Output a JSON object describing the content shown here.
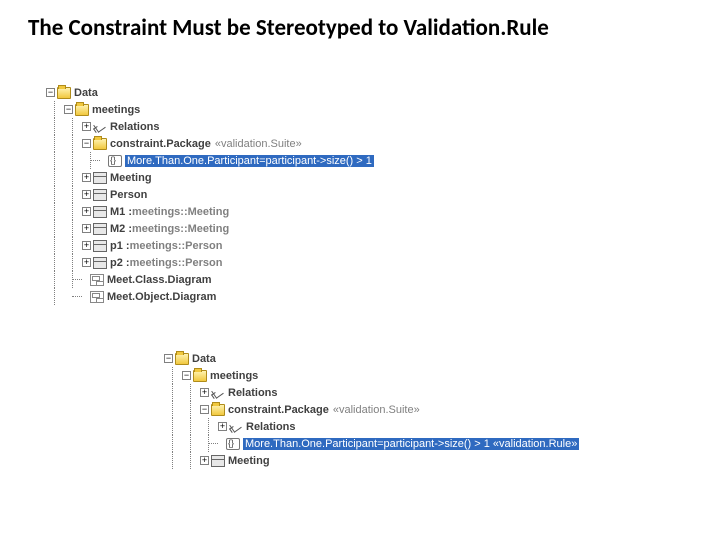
{
  "title": "The Constraint Must be Stereotyped to Validation.Rule",
  "tree1": {
    "data": "Data",
    "meetings": "meetings",
    "relations": "Relations",
    "constraintPackage": "constraint.Package",
    "constraintPackageStereo": "«validation.Suite»",
    "moreThanOne": "More.Than.One.Participant=participant->size() > 1",
    "meeting": "Meeting",
    "person": "Person",
    "m1": "M1 :",
    "m1type": " meetings::Meeting",
    "m2": "M2 :",
    "m2type": " meetings::Meeting",
    "p1": "p1 :",
    "p1type": " meetings::Person",
    "p2": "p2 :",
    "p2type": " meetings::Person",
    "meetClass": "Meet.Class.Diagram",
    "meetObject": "Meet.Object.Diagram"
  },
  "tree2": {
    "data": "Data",
    "meetings": "meetings",
    "relations": "Relations",
    "constraintPackage": "constraint.Package",
    "constraintPackageStereo": "«validation.Suite»",
    "relations2": "Relations",
    "moreThanOne": "More.Than.One.Participant=participant->size() > 1 «validation.Rule»",
    "meeting": "Meeting"
  }
}
